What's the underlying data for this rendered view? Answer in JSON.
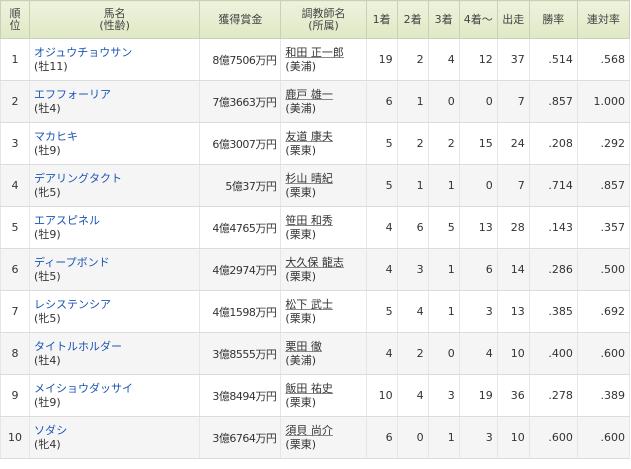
{
  "headers": {
    "rank_line1": "順",
    "rank_line2": "位",
    "horse_line1": "馬名",
    "horse_line2": "(性齢)",
    "prize": "獲得賞金",
    "trainer_line1": "調教師名",
    "trainer_line2": "(所属)",
    "first": "1着",
    "second": "2着",
    "third": "3着",
    "fourth_plus": "4着～",
    "starts": "出走",
    "win_rate": "勝率",
    "place_rate": "連対率"
  },
  "rows": [
    {
      "rank": "1",
      "horse": "オジュウチョウサン",
      "sex_age": "(牡11)",
      "prize": "8億7506万円",
      "trainer": "和田 正一郎",
      "affiliation": "(美浦)",
      "first": "19",
      "second": "2",
      "third": "4",
      "fourth_plus": "12",
      "starts": "37",
      "win_rate": ".514",
      "place_rate": ".568"
    },
    {
      "rank": "2",
      "horse": "エフフォーリア",
      "sex_age": "(牡4)",
      "prize": "7億3663万円",
      "trainer": "鹿戸 雄一",
      "affiliation": "(美浦)",
      "first": "6",
      "second": "1",
      "third": "0",
      "fourth_plus": "0",
      "starts": "7",
      "win_rate": ".857",
      "place_rate": "1.000"
    },
    {
      "rank": "3",
      "horse": "マカヒキ",
      "sex_age": "(牡9)",
      "prize": "6億3007万円",
      "trainer": "友道 康夫",
      "affiliation": "(栗東)",
      "first": "5",
      "second": "2",
      "third": "2",
      "fourth_plus": "15",
      "starts": "24",
      "win_rate": ".208",
      "place_rate": ".292"
    },
    {
      "rank": "4",
      "horse": "デアリングタクト",
      "sex_age": "(牝5)",
      "prize": "5億37万円",
      "trainer": "杉山 晴紀",
      "affiliation": "(栗東)",
      "first": "5",
      "second": "1",
      "third": "1",
      "fourth_plus": "0",
      "starts": "7",
      "win_rate": ".714",
      "place_rate": ".857"
    },
    {
      "rank": "5",
      "horse": "エアスピネル",
      "sex_age": "(牡9)",
      "prize": "4億4765万円",
      "trainer": "笹田 和秀",
      "affiliation": "(栗東)",
      "first": "4",
      "second": "6",
      "third": "5",
      "fourth_plus": "13",
      "starts": "28",
      "win_rate": ".143",
      "place_rate": ".357"
    },
    {
      "rank": "6",
      "horse": "ディープボンド",
      "sex_age": "(牡5)",
      "prize": "4億2974万円",
      "trainer": "大久保 龍志",
      "affiliation": "(栗東)",
      "first": "4",
      "second": "3",
      "third": "1",
      "fourth_plus": "6",
      "starts": "14",
      "win_rate": ".286",
      "place_rate": ".500"
    },
    {
      "rank": "7",
      "horse": "レシステンシア",
      "sex_age": "(牝5)",
      "prize": "4億1598万円",
      "trainer": "松下 武士",
      "affiliation": "(栗東)",
      "first": "5",
      "second": "4",
      "third": "1",
      "fourth_plus": "3",
      "starts": "13",
      "win_rate": ".385",
      "place_rate": ".692"
    },
    {
      "rank": "8",
      "horse": "タイトルホルダー",
      "sex_age": "(牡4)",
      "prize": "3億8555万円",
      "trainer": "栗田 徹",
      "affiliation": "(美浦)",
      "first": "4",
      "second": "2",
      "third": "0",
      "fourth_plus": "4",
      "starts": "10",
      "win_rate": ".400",
      "place_rate": ".600"
    },
    {
      "rank": "9",
      "horse": "メイショウダッサイ",
      "sex_age": "(牡9)",
      "prize": "3億8494万円",
      "trainer": "飯田 祐史",
      "affiliation": "(栗東)",
      "first": "10",
      "second": "4",
      "third": "3",
      "fourth_plus": "19",
      "starts": "36",
      "win_rate": ".278",
      "place_rate": ".389"
    },
    {
      "rank": "10",
      "horse": "ソダシ",
      "sex_age": "(牝4)",
      "prize": "3億6764万円",
      "trainer": "須貝 尚介",
      "affiliation": "(栗東)",
      "first": "6",
      "second": "0",
      "third": "1",
      "fourth_plus": "3",
      "starts": "10",
      "win_rate": ".600",
      "place_rate": ".600"
    }
  ]
}
